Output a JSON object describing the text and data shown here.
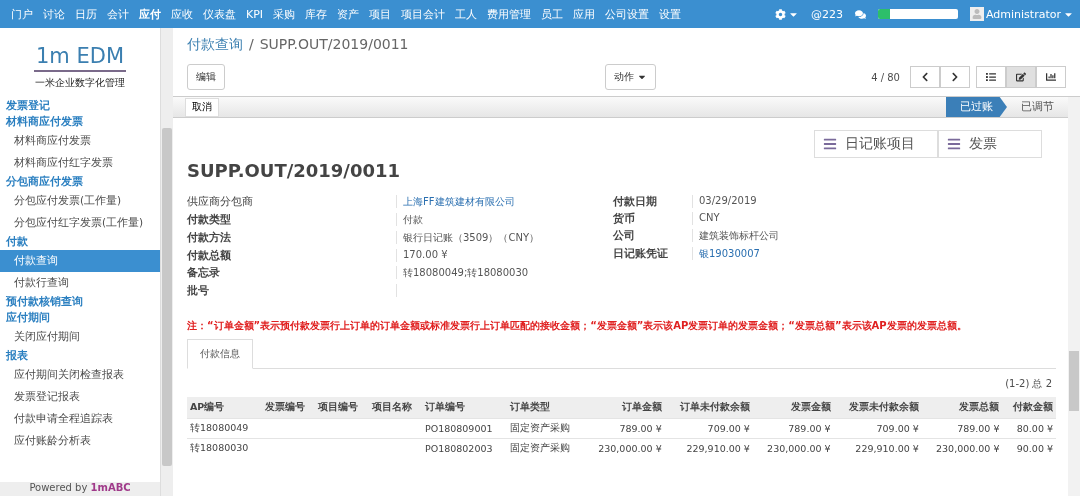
{
  "topbar": {
    "menu": [
      {
        "label": "门户",
        "selected": false
      },
      {
        "label": "讨论",
        "selected": false
      },
      {
        "label": "日历",
        "selected": false
      },
      {
        "label": "会计",
        "selected": false
      },
      {
        "label": "应付",
        "selected": true
      },
      {
        "label": "应收",
        "selected": false
      },
      {
        "label": "仪表盘",
        "selected": false
      },
      {
        "label": "KPI",
        "selected": false
      },
      {
        "label": "采购",
        "selected": false
      },
      {
        "label": "库存",
        "selected": false
      },
      {
        "label": "资产",
        "selected": false
      },
      {
        "label": "项目",
        "selected": false
      },
      {
        "label": "项目会计",
        "selected": false
      },
      {
        "label": "工人",
        "selected": false
      },
      {
        "label": "费用管理",
        "selected": false
      },
      {
        "label": "员工",
        "selected": false
      },
      {
        "label": "应用",
        "selected": false
      },
      {
        "label": "公司设置",
        "selected": false
      },
      {
        "label": "设置",
        "selected": false
      }
    ],
    "mentions": "@223",
    "progress": {
      "level": 0.15
    },
    "user": "Administrator"
  },
  "sidebar": {
    "logo": "1m EDM",
    "tagline": "一米企业数字化管理",
    "items": [
      {
        "kind": "header",
        "label": "发票登记",
        "selected": false
      },
      {
        "kind": "header",
        "label": "材料商应付发票",
        "selected": false
      },
      {
        "kind": "item",
        "label": "材料商应付发票",
        "selected": false
      },
      {
        "kind": "item",
        "label": "材料商应付红字发票",
        "selected": false
      },
      {
        "kind": "header",
        "label": "分包商应付发票",
        "selected": false
      },
      {
        "kind": "item",
        "label": "分包应付发票(工作量)",
        "selected": false
      },
      {
        "kind": "item",
        "label": "分包应付红字发票(工作量)",
        "selected": false
      },
      {
        "kind": "header",
        "label": "付款",
        "selected": false
      },
      {
        "kind": "item",
        "label": "付款查询",
        "selected": true
      },
      {
        "kind": "item",
        "label": "付款行查询",
        "selected": false
      },
      {
        "kind": "header",
        "label": "预付款核销查询",
        "selected": false
      },
      {
        "kind": "header",
        "label": "应付期间",
        "selected": false
      },
      {
        "kind": "item",
        "label": "关闭应付期间",
        "selected": false
      },
      {
        "kind": "header",
        "label": "报表",
        "selected": false
      },
      {
        "kind": "item",
        "label": "应付期间关闭检查报表",
        "selected": false
      },
      {
        "kind": "item",
        "label": "发票登记报表",
        "selected": false
      },
      {
        "kind": "item",
        "label": "付款申请全程追踪表",
        "selected": false
      },
      {
        "kind": "item",
        "label": "应付账龄分析表",
        "selected": false
      }
    ],
    "footer_prefix": "Powered by",
    "footer_brand": "1mABC"
  },
  "breadcrumb": {
    "parent": "付款查询",
    "separator": "/",
    "current": "SUPP.OUT/2019/0011"
  },
  "toolbar": {
    "edit": "编辑",
    "action": "动作",
    "pager": "4 / 80",
    "views": [
      {
        "kind": "list",
        "selected": false
      },
      {
        "kind": "form",
        "selected": true
      },
      {
        "kind": "graph",
        "selected": false
      }
    ]
  },
  "statusbar": {
    "cancel": "取消",
    "stages": [
      {
        "label": "已过账",
        "selected": true
      },
      {
        "label": "已调节",
        "selected": false
      }
    ]
  },
  "smart_buttons": [
    "日记账项目",
    "发票"
  ],
  "title": "SUPP.OUT/2019/0011",
  "fields_left": [
    {
      "label": "供应商分包商",
      "value": "上海FF建筑建材有限公司",
      "link": true,
      "bold": false
    },
    {
      "label": "付款类型",
      "value": "付款",
      "link": false,
      "bold": true
    },
    {
      "label": "付款方法",
      "value": "银行日记账（3509）（CNY）",
      "link": false,
      "bold": true
    },
    {
      "label": "付款总额",
      "value": "170.00 ¥",
      "link": false,
      "bold": true
    },
    {
      "label": "备忘录",
      "value": "转18080049;转18080030",
      "link": false,
      "bold": true
    },
    {
      "label": "批号",
      "bold": true
    }
  ],
  "fields_right": [
    {
      "label": "付款日期",
      "value": "03/29/2019",
      "link": false
    },
    {
      "label": "货币",
      "value": "CNY",
      "link": false
    },
    {
      "label": "公司",
      "value": "建筑装饰标杆公司",
      "link": false
    },
    {
      "label": "日记账凭证",
      "value": "银19030007",
      "link": true
    }
  ],
  "note": "注：“订单金额”表示预付款发票行上订单的订单金额或标准发票行上订单匹配的接收金额；“发票金额”表示该AP发票订单的发票金额；“发票总额”表示该AP发票的发票总额。",
  "tabs": [
    {
      "label": "付款信息",
      "selected": true
    }
  ],
  "table": {
    "pager": "(1-2) 总 2",
    "columns": [
      "AP编号",
      "发票编号",
      "项目编号",
      "项目名称",
      "订单编号",
      "订单类型",
      "订单金额",
      "订单未付款余额",
      "发票金额",
      "发票未付款余额",
      "发票总额",
      "付款金额"
    ],
    "rows": [
      [
        "转18080049",
        "",
        "",
        "",
        "PO180809001",
        "固定资产采购",
        "789.00 ¥",
        "709.00 ¥",
        "789.00 ¥",
        "709.00 ¥",
        "789.00 ¥",
        "80.00 ¥"
      ],
      [
        "转18080030",
        "",
        "",
        "",
        "PO180802003",
        "固定资产采购",
        "230,000.00 ¥",
        "229,910.00 ¥",
        "230,000.00 ¥",
        "229,910.00 ¥",
        "230,000.00 ¥",
        "90.00 ¥"
      ]
    ]
  }
}
